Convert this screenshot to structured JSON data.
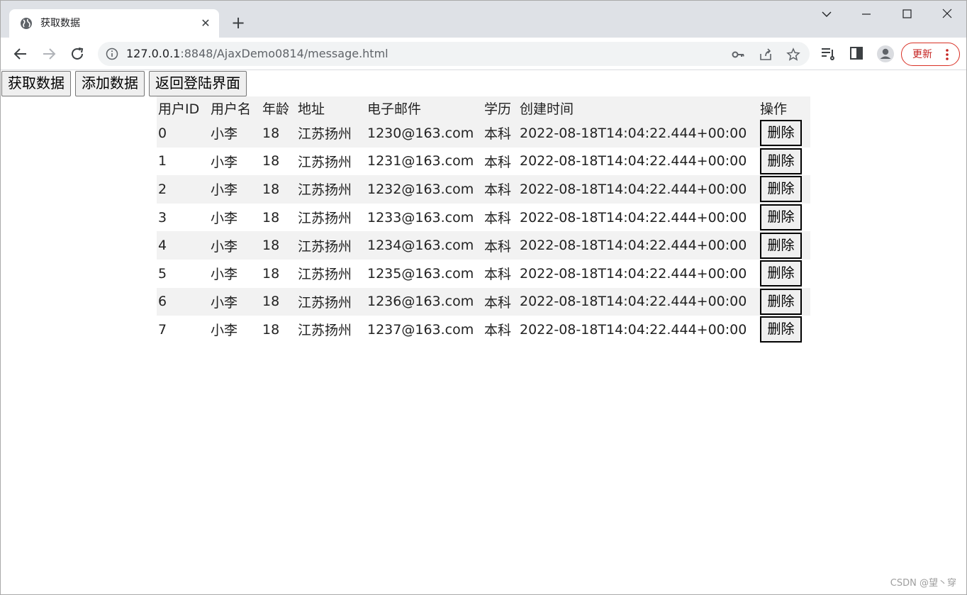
{
  "browser": {
    "tab_title": "获取数据",
    "tab_close": "✕",
    "new_tab": "+",
    "url_host": "127.0.0.1",
    "url_rest": ":8848/AjaxDemo0814/message.html",
    "update_label": "更新"
  },
  "toolbar": {
    "get_data": "获取数据",
    "add_data": "添加数据",
    "back_login": "返回登陆界面"
  },
  "table": {
    "headers": [
      "用户ID",
      "用户名",
      "年龄",
      "地址",
      "电子邮件",
      "学历",
      "创建时间",
      "操作"
    ],
    "rows": [
      {
        "id": "0",
        "name": "小李",
        "age": "18",
        "address": "江苏扬州",
        "email": "1230@163.com",
        "edu": "本科",
        "created": "2022-08-18T14:04:22.444+00:00",
        "action": "删除"
      },
      {
        "id": "1",
        "name": "小李",
        "age": "18",
        "address": "江苏扬州",
        "email": "1231@163.com",
        "edu": "本科",
        "created": "2022-08-18T14:04:22.444+00:00",
        "action": "删除"
      },
      {
        "id": "2",
        "name": "小李",
        "age": "18",
        "address": "江苏扬州",
        "email": "1232@163.com",
        "edu": "本科",
        "created": "2022-08-18T14:04:22.444+00:00",
        "action": "删除"
      },
      {
        "id": "3",
        "name": "小李",
        "age": "18",
        "address": "江苏扬州",
        "email": "1233@163.com",
        "edu": "本科",
        "created": "2022-08-18T14:04:22.444+00:00",
        "action": "删除"
      },
      {
        "id": "4",
        "name": "小李",
        "age": "18",
        "address": "江苏扬州",
        "email": "1234@163.com",
        "edu": "本科",
        "created": "2022-08-18T14:04:22.444+00:00",
        "action": "删除"
      },
      {
        "id": "5",
        "name": "小李",
        "age": "18",
        "address": "江苏扬州",
        "email": "1235@163.com",
        "edu": "本科",
        "created": "2022-08-18T14:04:22.444+00:00",
        "action": "删除"
      },
      {
        "id": "6",
        "name": "小李",
        "age": "18",
        "address": "江苏扬州",
        "email": "1236@163.com",
        "edu": "本科",
        "created": "2022-08-18T14:04:22.444+00:00",
        "action": "删除"
      },
      {
        "id": "7",
        "name": "小李",
        "age": "18",
        "address": "江苏扬州",
        "email": "1237@163.com",
        "edu": "本科",
        "created": "2022-08-18T14:04:22.444+00:00",
        "action": "删除"
      }
    ]
  },
  "watermark": "CSDN @望丶穿",
  "colors": {
    "tabstrip_bg": "#dee1e6",
    "omnibox_bg": "#f1f3f4",
    "update_accent": "#d93025",
    "zebra_row": "#f2f2f2"
  }
}
